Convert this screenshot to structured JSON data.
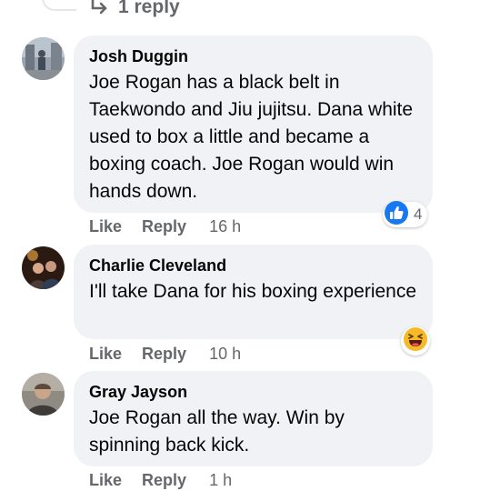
{
  "thread": {
    "reply_count_label": "1 reply"
  },
  "comments": [
    {
      "author": "Josh Duggin",
      "text": "Joe Rogan has a black belt in Taekwondo and Jiu jujitsu. Dana white used to box a little and became a boxing coach. Joe Rogan would win hands down.",
      "like_label": "Like",
      "reply_label": "Reply",
      "time": "16 h",
      "reaction": {
        "icon": "thumbs-up-icon",
        "count": "4",
        "color": "#1877f2"
      }
    },
    {
      "author": "Charlie Cleveland",
      "text": "I'll take Dana for his boxing experience",
      "like_label": "Like",
      "reply_label": "Reply",
      "time": "10 h",
      "reaction": {
        "icon": "laughing-emoji-icon",
        "color": "#f7b928"
      }
    },
    {
      "author": "Gray Jayson",
      "text": "Joe Rogan all the way. Win by spinning back kick.",
      "like_label": "Like",
      "reply_label": "Reply",
      "time": "1 h"
    }
  ]
}
